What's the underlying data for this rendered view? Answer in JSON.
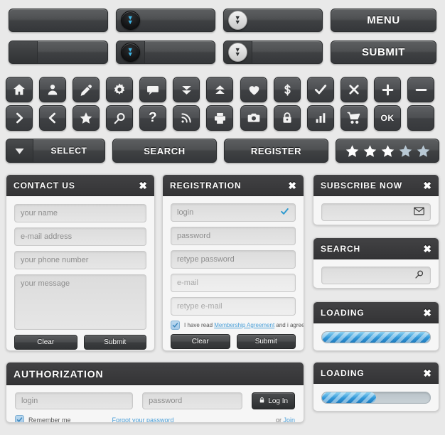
{
  "colors": {
    "background": "#e9e9e9",
    "button_dark": "#4e5052",
    "header_dark": "#3a3a3c",
    "accent_blue": "#3fb7e8",
    "link_blue": "#4a9fd8",
    "progress_blue": "#2f96d8",
    "star_off": "#b8c8d4"
  },
  "top_buttons": {
    "row1": [
      {
        "name": "plain-button",
        "label": "",
        "badge": "none"
      },
      {
        "name": "dropdown-button-dark-badge",
        "label": "",
        "badge": "dark"
      },
      {
        "name": "dropdown-button-light-badge",
        "label": "",
        "badge": "light"
      },
      {
        "name": "menu-button",
        "label": "MENU",
        "badge": "none"
      }
    ],
    "row2": [
      {
        "name": "split-button-plain",
        "label": "",
        "badge": "none"
      },
      {
        "name": "split-button-dark-badge",
        "label": "",
        "badge": "dark"
      },
      {
        "name": "split-button-light-badge",
        "label": "",
        "badge": "light"
      },
      {
        "name": "submit-button",
        "label": "SUBMIT",
        "badge": "none"
      }
    ]
  },
  "icon_row1": [
    "home-icon",
    "user-icon",
    "pencil-icon",
    "gear-icon",
    "chat-bubble-icon",
    "double-chevron-down-icon",
    "double-chevron-up-icon",
    "heart-icon",
    "dollar-icon",
    "check-icon",
    "close-x-icon",
    "plus-icon",
    "minus-icon"
  ],
  "icon_row2": [
    "chevron-right-icon",
    "chevron-left-icon",
    "star-icon",
    "search-icon",
    "question-icon",
    "rss-icon",
    "printer-icon",
    "camera-icon",
    "lock-icon",
    "bar-chart-icon",
    "shopping-cart-icon",
    "ok-button",
    "blank-button"
  ],
  "ok_label": "OK",
  "action_row": {
    "select_label": "SELECT",
    "search_label": "SEARCH",
    "register_label": "REGISTER",
    "rating": {
      "total": 5,
      "filled": 3
    }
  },
  "contact_us": {
    "title": "CONTACT US",
    "close": "✖",
    "fields": [
      {
        "name": "name-input",
        "placeholder": "your name"
      },
      {
        "name": "email-input",
        "placeholder": "e-mail address"
      },
      {
        "name": "phone-input",
        "placeholder": "your phone number"
      },
      {
        "name": "message-textarea",
        "placeholder": "your message"
      }
    ],
    "clear_label": "Clear",
    "submit_label": "Submit"
  },
  "registration": {
    "title": "REGISTRATION",
    "close": "✖",
    "fields": [
      {
        "name": "login-input",
        "placeholder": "login",
        "valid": true
      },
      {
        "name": "password-input",
        "placeholder": "password",
        "valid": false
      },
      {
        "name": "retype-password-input",
        "placeholder": "retype password",
        "valid": false
      },
      {
        "name": "email-input",
        "placeholder": "e-mail",
        "valid": false
      },
      {
        "name": "retype-email-input",
        "placeholder": "retype e-mail",
        "valid": false
      }
    ],
    "agreement_pre": "I have read ",
    "agreement_link": "Membership Agreement",
    "agreement_post": " and i agree with it",
    "checked": true,
    "clear_label": "Clear",
    "submit_label": "Submit"
  },
  "subscribe": {
    "title": "SUBSCRIBE NOW",
    "close": "✖",
    "input_placeholder": "",
    "icon": "envelope-icon"
  },
  "search_panel": {
    "title": "SEARCH",
    "close": "✖",
    "input_placeholder": "",
    "icon": "search-icon"
  },
  "loading1": {
    "title": "LOADING",
    "close": "✖",
    "progress": 100
  },
  "loading2": {
    "title": "LOADING",
    "close": "✖",
    "progress": 50
  },
  "authorization": {
    "title": "AUTHORIZATION",
    "login_placeholder": "login",
    "password_placeholder": "password",
    "login_button": "Log In",
    "login_icon": "lock-icon",
    "remember_label": "Remember me",
    "remember_checked": true,
    "forgot_link": "Forgot your password",
    "or_text": "or ",
    "join_link": "Join"
  }
}
